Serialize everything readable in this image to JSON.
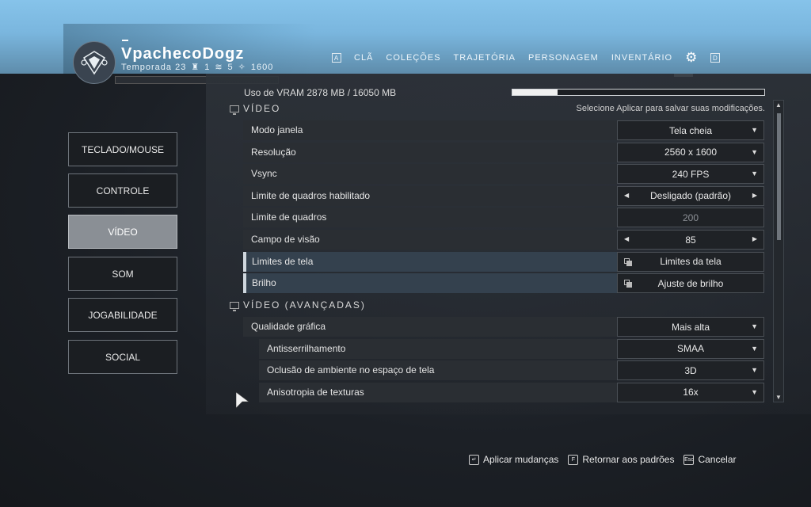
{
  "header": {
    "player_name": "VpachecoDogz",
    "season": "Temporada 23",
    "stat1": "1",
    "stat2": "5",
    "power": "1600",
    "nav_key_left": "A",
    "nav_key_right": "D",
    "nav": [
      {
        "label": "CLÃ"
      },
      {
        "label": "COLEÇÕES"
      },
      {
        "label": "TRAJETÓRIA"
      },
      {
        "label": "PERSONAGEM"
      },
      {
        "label": "INVENTÁRIO"
      }
    ]
  },
  "menu": {
    "items": [
      {
        "label": "TECLADO/MOUSE"
      },
      {
        "label": "CONTROLE"
      },
      {
        "label": "VÍDEO"
      },
      {
        "label": "SOM"
      },
      {
        "label": "JOGABILIDADE"
      },
      {
        "label": "SOCIAL"
      }
    ],
    "active": "VÍDEO"
  },
  "vram": {
    "label": "Uso de VRAM 2878 MB / 16050 MB",
    "used": 2878,
    "total": 16050
  },
  "sections": {
    "video_title": "VÍDEO",
    "video_hint": "Selecione Aplicar para salvar suas modificações.",
    "advanced_title": "VÍDEO (AVANÇADAS)"
  },
  "video_rows": [
    {
      "label": "Modo janela",
      "value": "Tela cheia",
      "type": "dropdown"
    },
    {
      "label": "Resolução",
      "value": "2560 x 1600",
      "type": "dropdown"
    },
    {
      "label": "Vsync",
      "value": "240 FPS",
      "type": "dropdown"
    },
    {
      "label": "Limite de quadros habilitado",
      "value": "Desligado (padrão)",
      "type": "selector"
    },
    {
      "label": "Limite de quadros",
      "value": "200",
      "type": "disabled"
    },
    {
      "label": "Campo de visão",
      "value": "85",
      "type": "selector"
    },
    {
      "label": "Limites de tela",
      "value": "Limites da tela",
      "type": "button"
    },
    {
      "label": "Brilho",
      "value": "Ajuste de brilho",
      "type": "button"
    }
  ],
  "advanced_rows": [
    {
      "label": "Qualidade gráfica",
      "value": "Mais alta",
      "type": "dropdown"
    },
    {
      "label": "Antisserrilhamento",
      "value": "SMAA",
      "type": "dropdown"
    },
    {
      "label": "Oclusão de ambiente no espaço de tela",
      "value": "3D",
      "type": "dropdown"
    },
    {
      "label": "Anisotropia de texturas",
      "value": "16x",
      "type": "dropdown"
    }
  ],
  "footer": {
    "apply": {
      "key": "↵",
      "label": "Aplicar mudanças"
    },
    "reset": {
      "key": "F",
      "label": "Retornar aos padrões"
    },
    "cancel": {
      "key": "Esc",
      "label": "Cancelar"
    }
  }
}
